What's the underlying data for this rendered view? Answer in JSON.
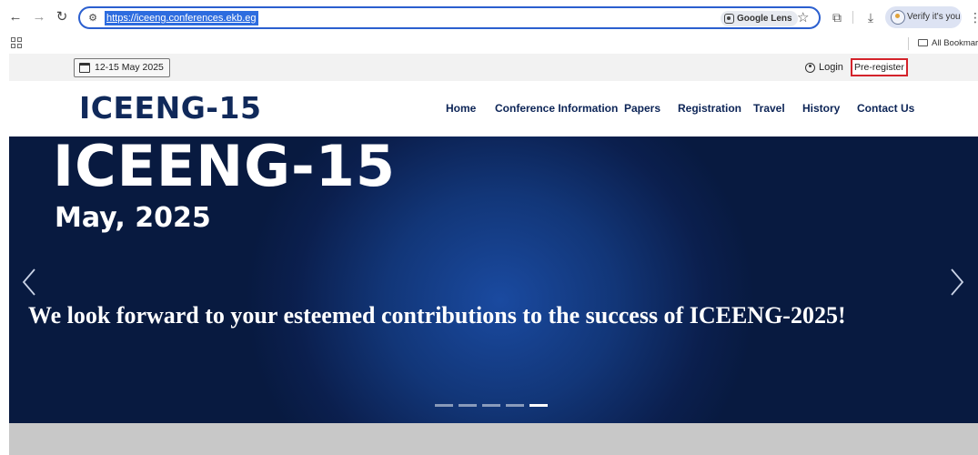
{
  "browser": {
    "url": "https://iceeng.conferences.ekb.eg",
    "lens_label": "Google Lens",
    "verify_label": "Verify it's you",
    "bookmarks_label": "All Bookmark",
    "icons": [
      "back-icon",
      "forward-icon",
      "reload-icon",
      "site-settings-icon",
      "google-lens-icon",
      "star-icon",
      "extensions-icon",
      "download-icon",
      "kebab-menu-icon",
      "apps-icon",
      "folder-icon"
    ]
  },
  "site": {
    "topbar": {
      "date": "12-15 May 2025",
      "login": "Login",
      "preregister": "Pre-register"
    },
    "logo": "ICEENG-15",
    "nav": [
      {
        "label": "Home"
      },
      {
        "label": "Conference Information"
      },
      {
        "label": "Papers"
      },
      {
        "label": "Registration"
      },
      {
        "label": "Travel"
      },
      {
        "label": "History"
      },
      {
        "label": "Contact Us"
      }
    ],
    "hero": {
      "title": "ICEENG-15",
      "subtitle": "May, 2025",
      "message": "We look forward to your esteemed contributions to the success of ICEENG-2025!",
      "slide_count": 5,
      "active_slide": 5
    },
    "colors": {
      "brand_navy": "#10295a",
      "hero_blue": "#123678",
      "highlight_red": "#d4232b",
      "url_selection": "#2d6cdf"
    }
  }
}
